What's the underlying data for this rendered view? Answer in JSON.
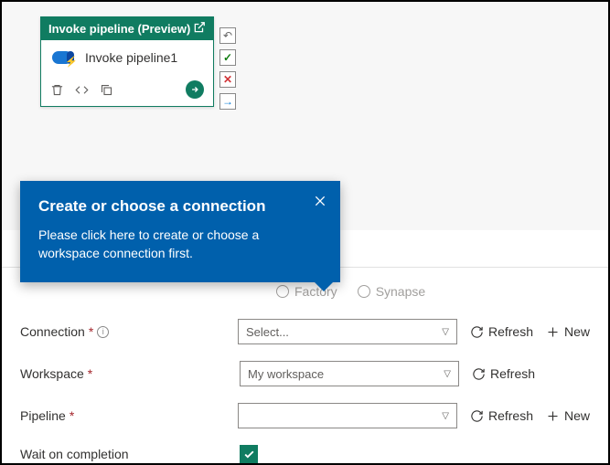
{
  "activity": {
    "header": "Invoke pipeline (Preview)",
    "name": "Invoke pipeline1"
  },
  "tooltip": {
    "title": "Create or choose a connection",
    "body": "Please click here to create or choose a workspace connection first."
  },
  "radios": {
    "factory": "Factory",
    "synapse": "Synapse"
  },
  "form": {
    "connection_label": "Connection",
    "connection_value": "Select...",
    "workspace_label": "Workspace",
    "workspace_value": "My workspace",
    "pipeline_label": "Pipeline",
    "pipeline_value": "",
    "wait_label": "Wait on completion",
    "refresh": "Refresh",
    "new": "New"
  }
}
